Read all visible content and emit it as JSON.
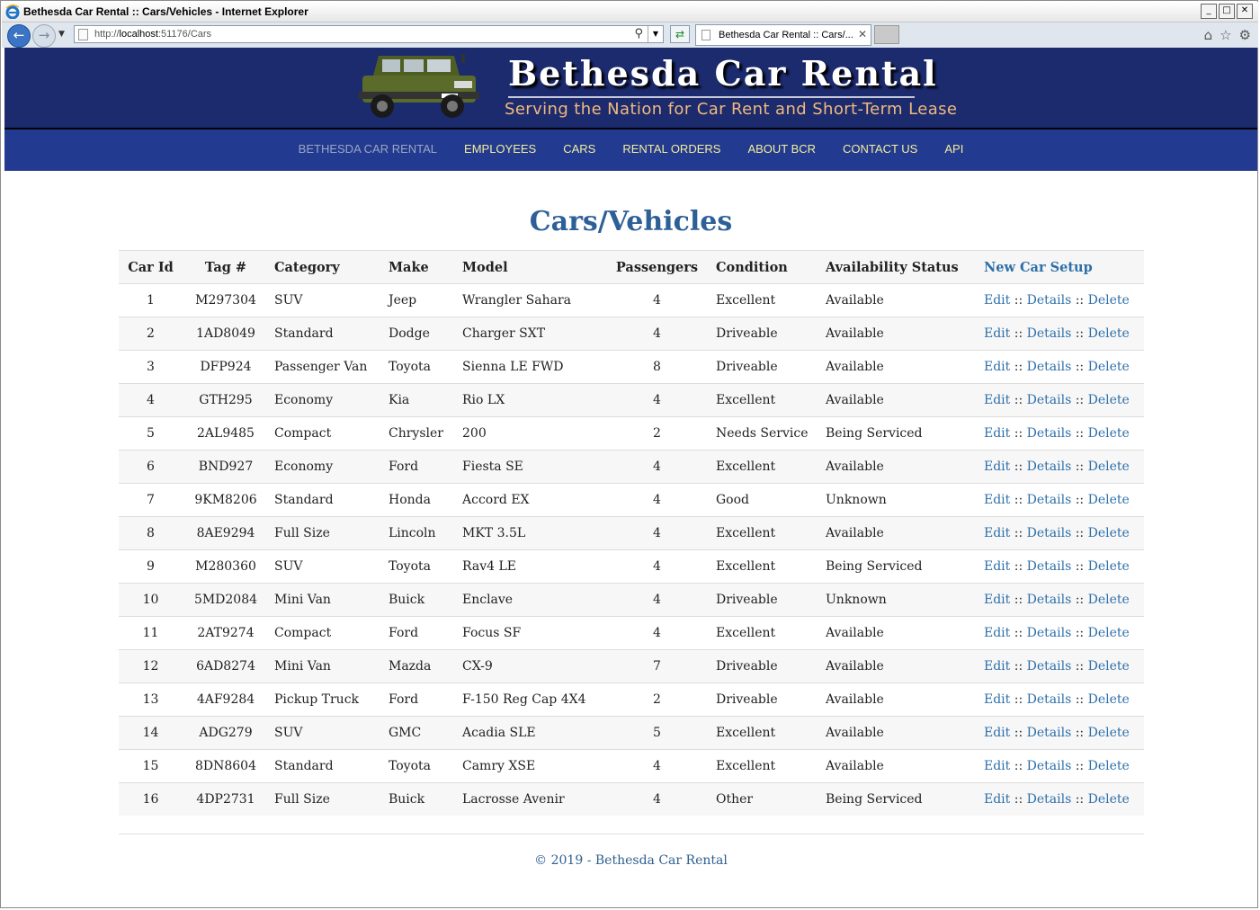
{
  "window": {
    "title": "Bethesda Car Rental :: Cars/Vehicles - Internet Explorer",
    "controls": [
      "_",
      "□",
      "✕"
    ]
  },
  "browser": {
    "url_prefix": "http://",
    "url_host": "localhost",
    "url_rest": ":51176/Cars",
    "tab_label": "Bethesda Car Rental :: Cars/...",
    "icons": [
      "back-icon",
      "forward-icon",
      "home-icon",
      "favorites-icon",
      "settings-icon"
    ]
  },
  "site": {
    "title": "Bethesda Car Rental",
    "tagline": "Serving the Nation for Car Rent and Short-Term Lease",
    "colors": {
      "header": "#1c2a6e",
      "menu": "#223a8f",
      "menu_text": "#f4ee9c",
      "heading": "#2e6098"
    }
  },
  "menu": {
    "brand": "BETHESDA CAR RENTAL",
    "items": [
      "EMPLOYEES",
      "CARS",
      "RENTAL ORDERS",
      "ABOUT BCR",
      "CONTACT US",
      "API"
    ]
  },
  "page": {
    "heading": "Cars/Vehicles",
    "columns": [
      "Car Id",
      "Tag #",
      "Category",
      "Make",
      "Model",
      "Passengers",
      "Condition",
      "Availability Status"
    ],
    "new_link": "New Car Setup",
    "actions": {
      "edit": "Edit",
      "details": "Details",
      "delete": "Delete",
      "separator": "::"
    },
    "rows": [
      [
        "1",
        "M297304",
        "SUV",
        "Jeep",
        "Wrangler Sahara",
        "4",
        "Excellent",
        "Available"
      ],
      [
        "2",
        "1AD8049",
        "Standard",
        "Dodge",
        "Charger SXT",
        "4",
        "Driveable",
        "Available"
      ],
      [
        "3",
        "DFP924",
        "Passenger Van",
        "Toyota",
        "Sienna LE FWD",
        "8",
        "Driveable",
        "Available"
      ],
      [
        "4",
        "GTH295",
        "Economy",
        "Kia",
        "Rio LX",
        "4",
        "Excellent",
        "Available"
      ],
      [
        "5",
        "2AL9485",
        "Compact",
        "Chrysler",
        "200",
        "2",
        "Needs Service",
        "Being Serviced"
      ],
      [
        "6",
        "BND927",
        "Economy",
        "Ford",
        "Fiesta SE",
        "4",
        "Excellent",
        "Available"
      ],
      [
        "7",
        "9KM8206",
        "Standard",
        "Honda",
        "Accord EX",
        "4",
        "Good",
        "Unknown"
      ],
      [
        "8",
        "8AE9294",
        "Full Size",
        "Lincoln",
        "MKT 3.5L",
        "4",
        "Excellent",
        "Available"
      ],
      [
        "9",
        "M280360",
        "SUV",
        "Toyota",
        "Rav4 LE",
        "4",
        "Excellent",
        "Being Serviced"
      ],
      [
        "10",
        "5MD2084",
        "Mini Van",
        "Buick",
        "Enclave",
        "4",
        "Driveable",
        "Unknown"
      ],
      [
        "11",
        "2AT9274",
        "Compact",
        "Ford",
        "Focus SF",
        "4",
        "Excellent",
        "Available"
      ],
      [
        "12",
        "6AD8274",
        "Mini Van",
        "Mazda",
        "CX-9",
        "7",
        "Driveable",
        "Available"
      ],
      [
        "13",
        "4AF9284",
        "Pickup Truck",
        "Ford",
        "F-150 Reg Cap 4X4",
        "2",
        "Driveable",
        "Available"
      ],
      [
        "14",
        "ADG279",
        "SUV",
        "GMC",
        "Acadia SLE",
        "5",
        "Excellent",
        "Available"
      ],
      [
        "15",
        "8DN8604",
        "Standard",
        "Toyota",
        "Camry XSE",
        "4",
        "Excellent",
        "Available"
      ],
      [
        "16",
        "4DP2731",
        "Full Size",
        "Buick",
        "Lacrosse Avenir",
        "4",
        "Other",
        "Being Serviced"
      ]
    ]
  },
  "footer": {
    "text": "© 2019 - Bethesda Car Rental"
  }
}
